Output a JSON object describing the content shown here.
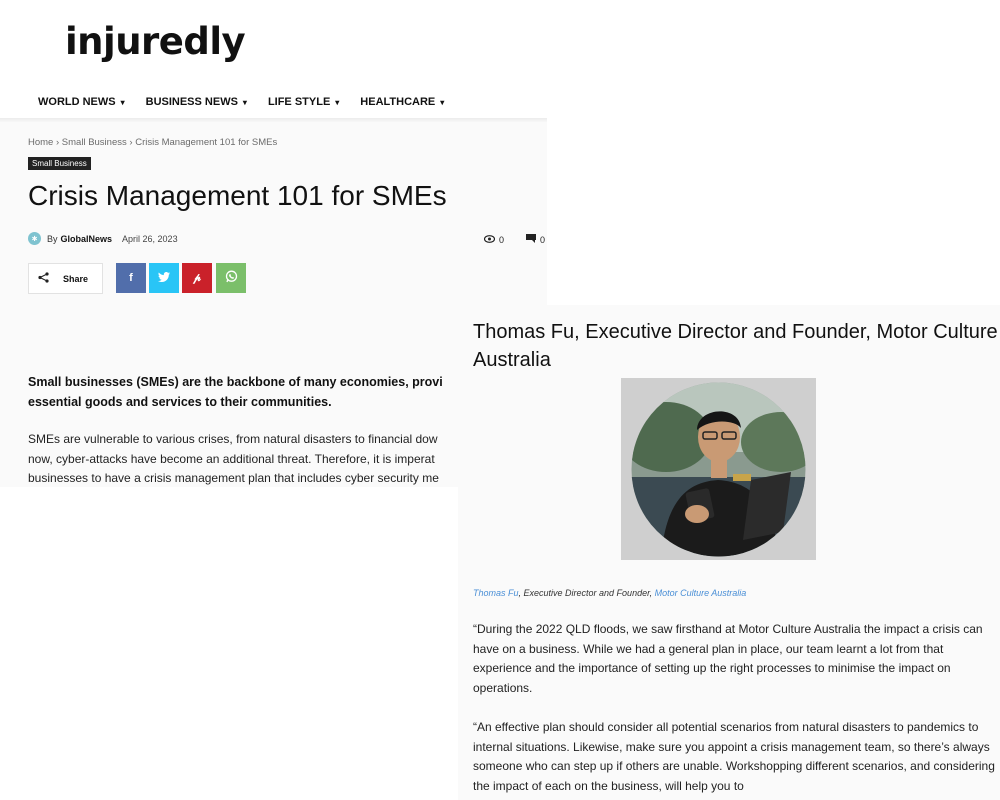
{
  "site": {
    "logo": "injuredly"
  },
  "nav": [
    {
      "label": "WORLD NEWS"
    },
    {
      "label": "BUSINESS NEWS"
    },
    {
      "label": "LIFE STYLE"
    },
    {
      "label": "HEALTHCARE"
    }
  ],
  "breadcrumb": {
    "home": "Home",
    "section": "Small Business",
    "current": "Crisis Management 101 for SMEs",
    "separator": "›"
  },
  "category_badge": "Small Business",
  "article": {
    "title": "Crisis Management 101 for SMEs",
    "by": "By",
    "author": "GlobalNews",
    "date": "April 26, 2023",
    "views": "0",
    "comments": "0"
  },
  "share": {
    "label": "Share",
    "buttons": [
      {
        "icon": "facebook-icon",
        "glyph": "f",
        "color": "#516eab"
      },
      {
        "icon": "twitter-icon",
        "glyph": "t",
        "color": "#29c5f6"
      },
      {
        "icon": "pinterest-icon",
        "glyph": "p",
        "color": "#ca212a"
      },
      {
        "icon": "whatsapp-icon",
        "glyph": "w",
        "color": "#7bbf6a"
      }
    ]
  },
  "body_left": {
    "lead_line1": "Small businesses (SMEs) are the backbone of many economies, provi",
    "lead_line2": "essential goods and services to their communities.",
    "para_line1": "SMEs are vulnerable to various crises, from natural disasters to financial dow",
    "para_line2": "now, cyber-attacks have become an additional threat. Therefore, it is imperat",
    "para_line3": "businesses to have a crisis management plan that includes cyber security me"
  },
  "body_right": {
    "heading": "Thomas Fu, Executive Director and Founder, Motor Culture Australia",
    "caption_name": "Thomas Fu",
    "caption_role": ", Executive Director and Founder, ",
    "caption_org": "Motor Culture Australia",
    "para1": "“During the 2022 QLD floods, we saw firsthand at Motor Culture Australia the impact a crisis can have on a business. While we had a general plan in place, our team learnt a lot from that experience and the importance of setting up the right processes to minimise the impact on operations.",
    "para2": "“An effective plan should consider all potential scenarios from natural disasters to pandemics to internal situations. Likewise, make sure you appoint a crisis management team, so there’s always someone who can step up if others are unable. Workshopping different scenarios, and considering the impact of each on the business, will help you to"
  },
  "colors": {
    "accent_link": "#4a8fd6",
    "badge_bg": "#222222"
  }
}
